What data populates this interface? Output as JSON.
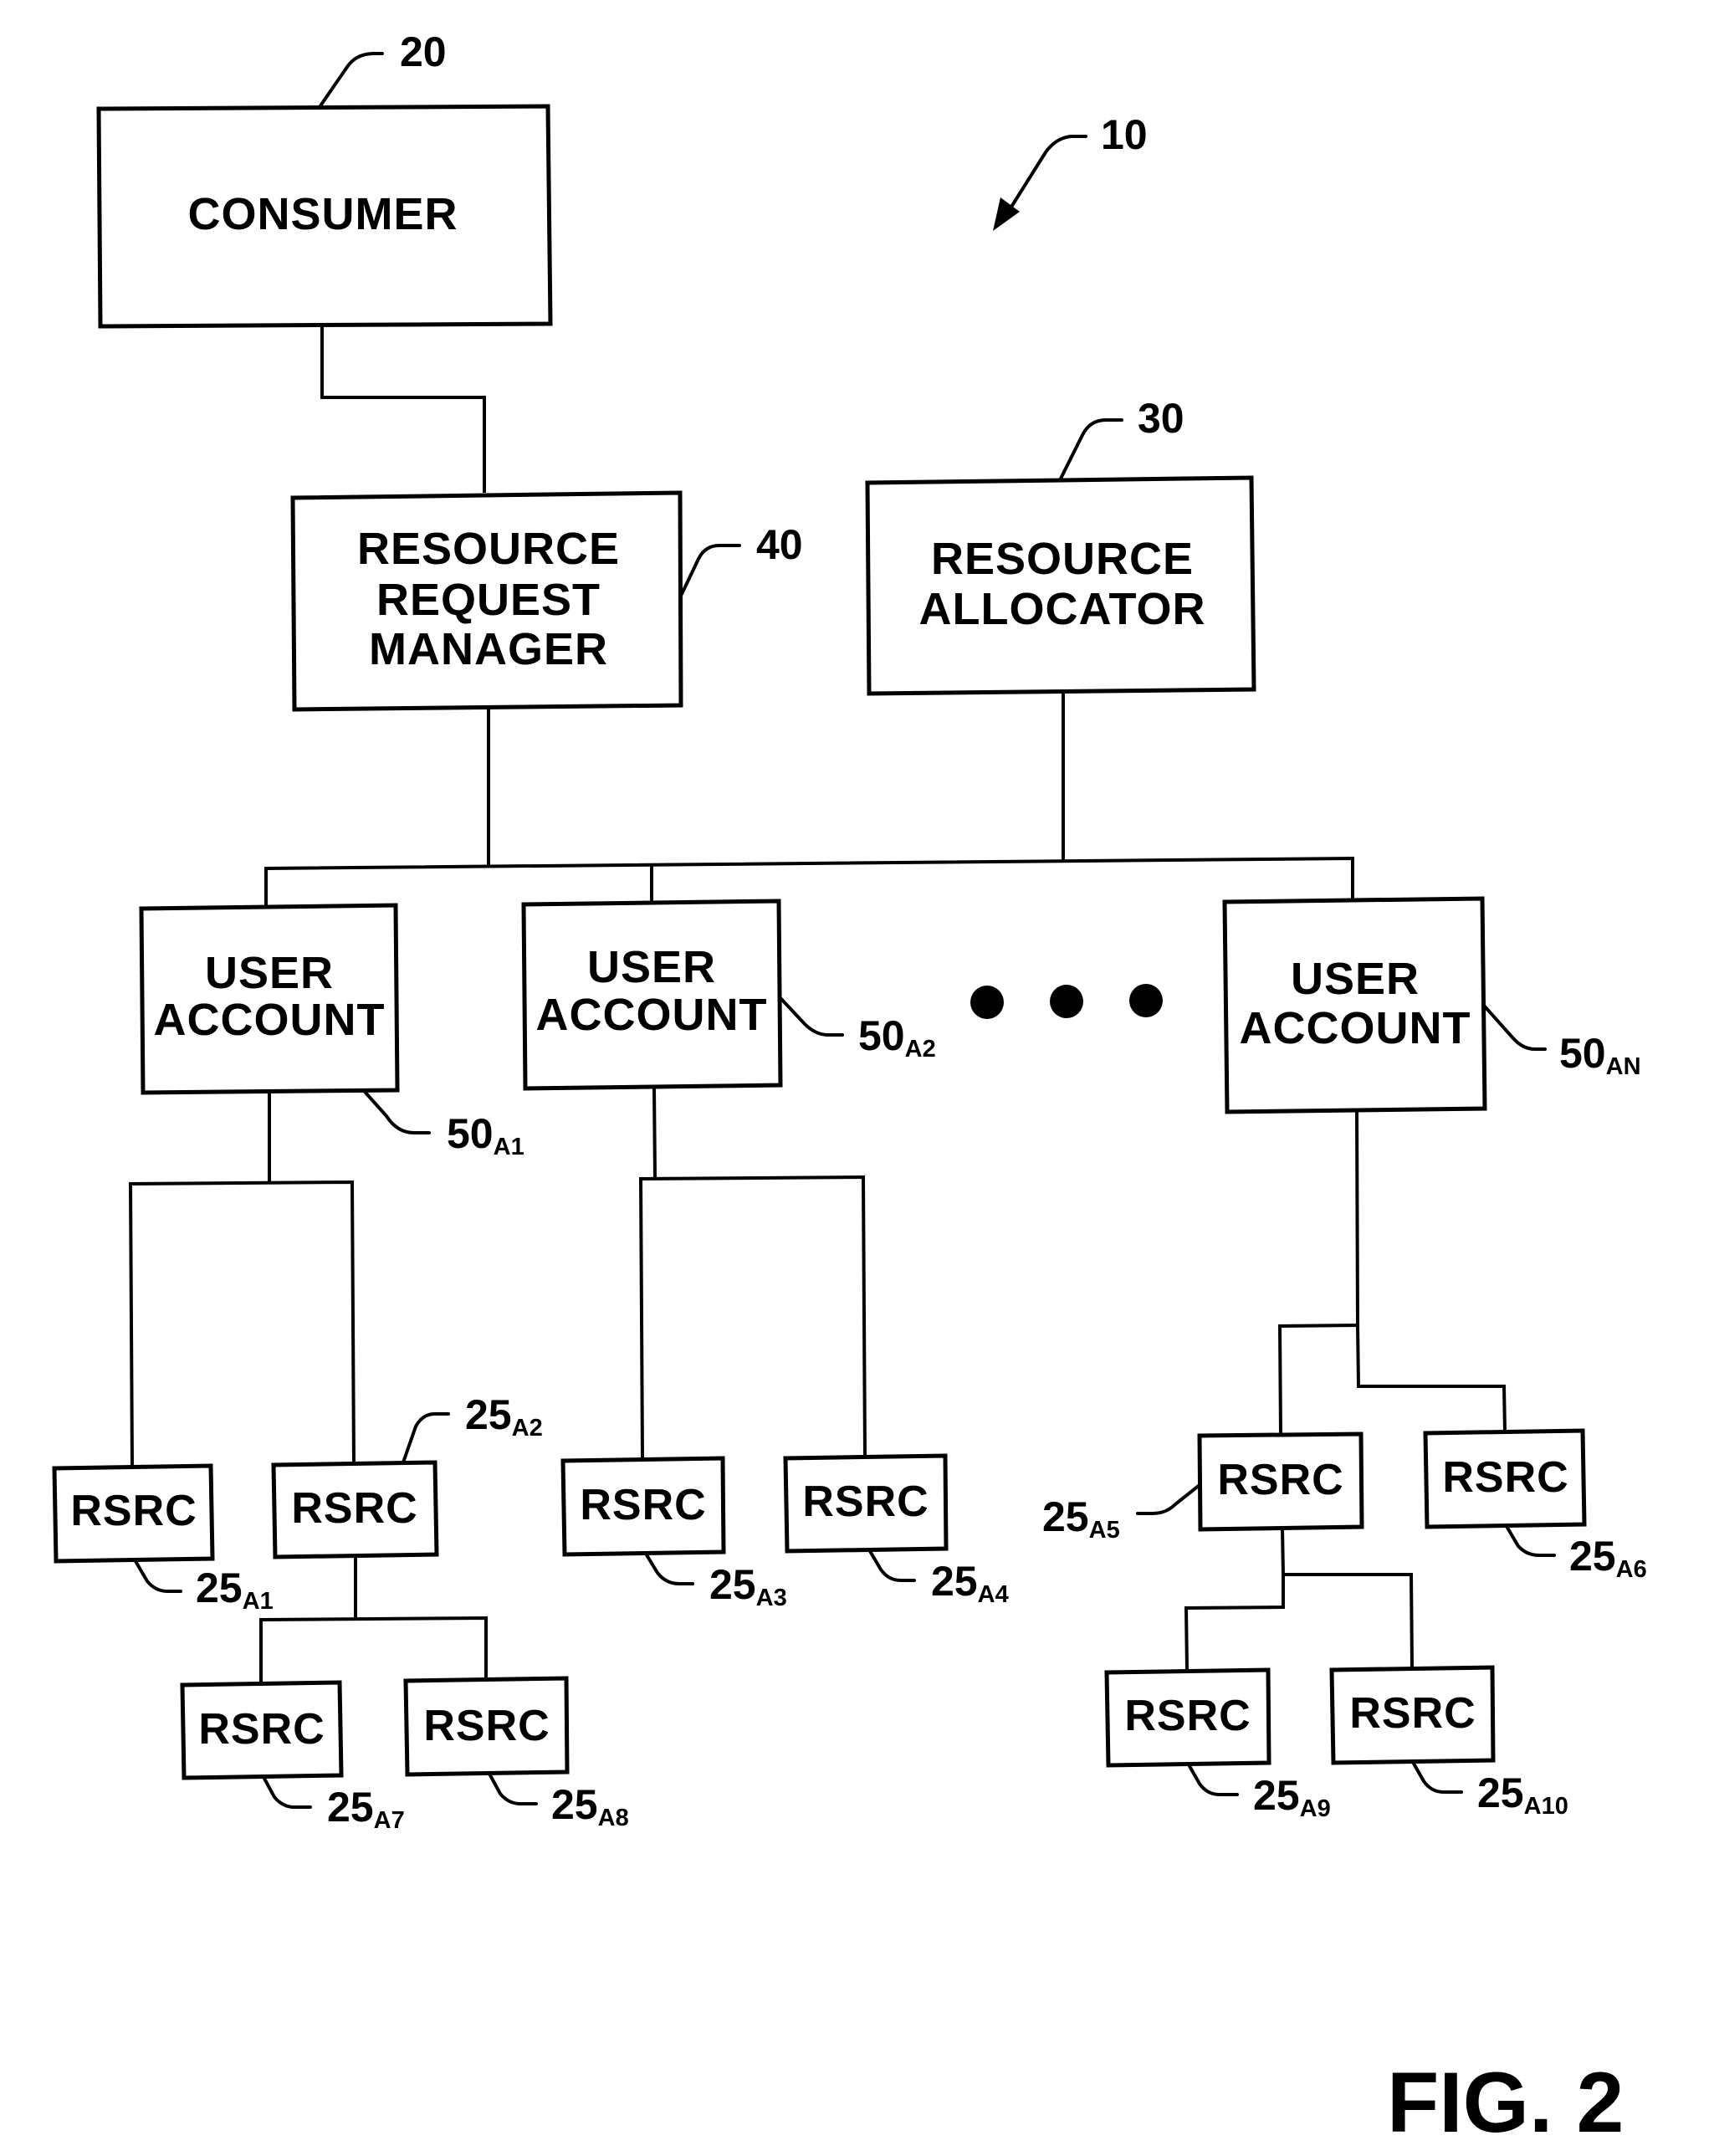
{
  "figure": {
    "caption": "FIG. 2",
    "system_ref": "10"
  },
  "consumer": {
    "label": "CONSUMER",
    "ref": "20"
  },
  "resource_request_manager": {
    "lines": [
      "RESOURCE",
      "REQUEST",
      "MANAGER"
    ],
    "ref": "40"
  },
  "resource_allocator": {
    "lines": [
      "RESOURCE",
      "ALLOCATOR"
    ],
    "ref": "30"
  },
  "user_accounts": [
    {
      "lines": [
        "USER",
        "ACCOUNT"
      ],
      "ref": "50",
      "sub": "A1"
    },
    {
      "lines": [
        "USER",
        "ACCOUNT"
      ],
      "ref": "50",
      "sub": "A2"
    },
    {
      "lines": [
        "USER",
        "ACCOUNT"
      ],
      "ref": "50",
      "sub": "AN"
    }
  ],
  "ellipsis": "• • •",
  "resources": [
    {
      "label": "RSRC",
      "ref": "25",
      "sub": "A1",
      "parent": "user-account-A1"
    },
    {
      "label": "RSRC",
      "ref": "25",
      "sub": "A2",
      "parent": "user-account-A1"
    },
    {
      "label": "RSRC",
      "ref": "25",
      "sub": "A3",
      "parent": "user-account-A2"
    },
    {
      "label": "RSRC",
      "ref": "25",
      "sub": "A4",
      "parent": "user-account-A2"
    },
    {
      "label": "RSRC",
      "ref": "25",
      "sub": "A5",
      "parent": "user-account-AN"
    },
    {
      "label": "RSRC",
      "ref": "25",
      "sub": "A6",
      "parent": "user-account-AN"
    },
    {
      "label": "RSRC",
      "ref": "25",
      "sub": "A7",
      "parent": "resource-A2"
    },
    {
      "label": "RSRC",
      "ref": "25",
      "sub": "A8",
      "parent": "resource-A2"
    },
    {
      "label": "RSRC",
      "ref": "25",
      "sub": "A9",
      "parent": "resource-A5"
    },
    {
      "label": "RSRC",
      "ref": "25",
      "sub": "A10",
      "parent": "resource-A5"
    }
  ]
}
